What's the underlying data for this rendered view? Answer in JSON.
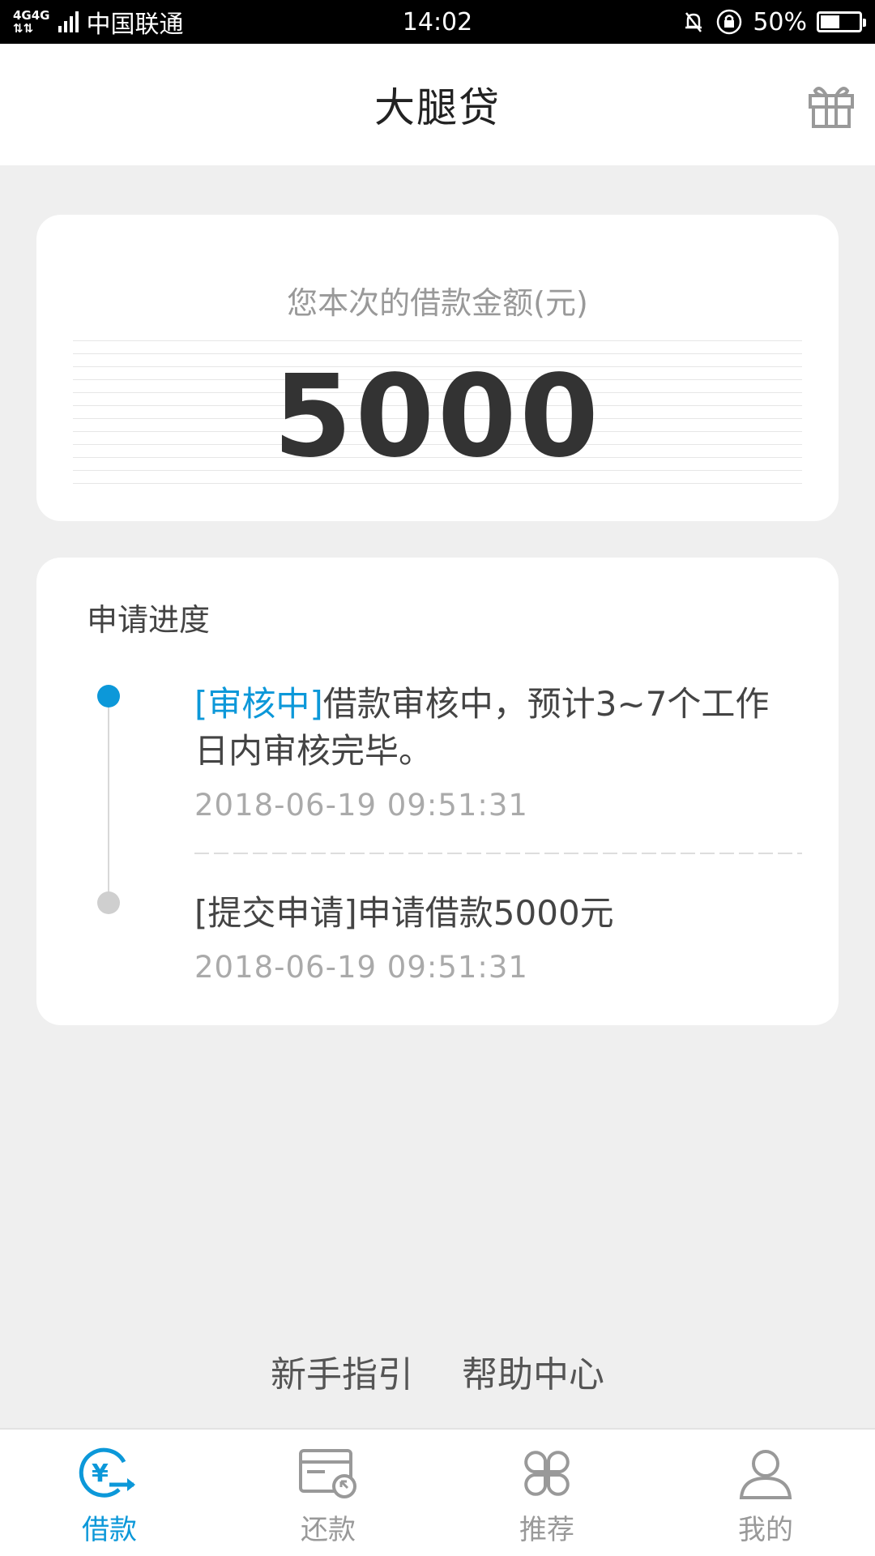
{
  "status_bar": {
    "network": "4G 4G",
    "carrier": "中国联通",
    "time": "14:02",
    "battery": "50%",
    "battery_level": 0.5
  },
  "header": {
    "title": "大腿贷",
    "gift_icon": "gift-icon"
  },
  "amount_card": {
    "label": "您本次的借款金额(元)",
    "amount": "5000"
  },
  "progress": {
    "title": "申请进度",
    "entries": [
      {
        "tag": "[审核中]",
        "text": "借款审核中，预计3~7个工作日内审核完毕。",
        "time": "2018-06-19 09:51:31",
        "status": "active"
      },
      {
        "tag": "[提交申请]",
        "text": "申请借款5000元",
        "time": "2018-06-19 09:51:31",
        "status": "done"
      }
    ]
  },
  "footer_links": {
    "guide": "新手指引",
    "help": "帮助中心"
  },
  "tabs": [
    {
      "label": "借款",
      "icon": "loan-icon",
      "active": true
    },
    {
      "label": "还款",
      "icon": "repay-card-icon",
      "active": false
    },
    {
      "label": "推荐",
      "icon": "recommend-grid-icon",
      "active": false
    },
    {
      "label": "我的",
      "icon": "profile-icon",
      "active": false
    }
  ],
  "colors": {
    "accent": "#0c98d9",
    "background": "#efefef",
    "inactive": "#999999"
  }
}
